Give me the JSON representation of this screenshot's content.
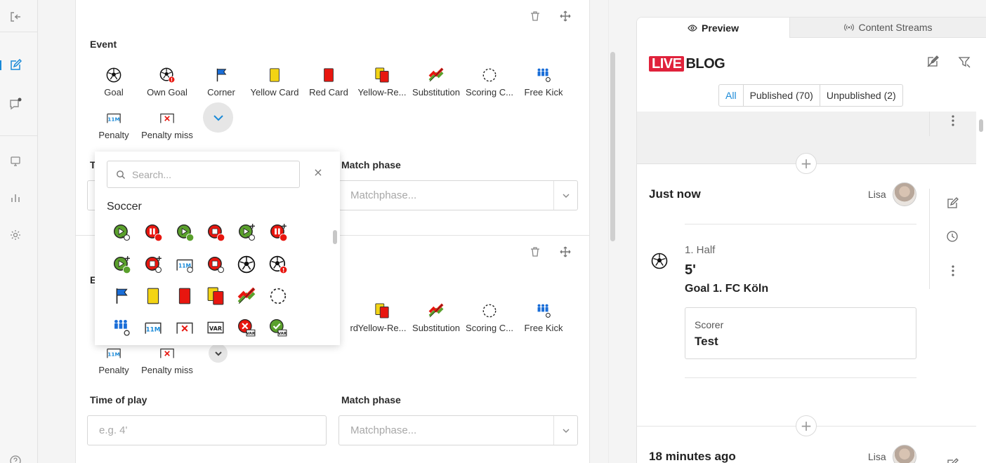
{
  "editor": {
    "event_label": "Event",
    "time_of_play_label": "Time of play",
    "match_phase_label": "Match phase",
    "time_placeholder": "e.g. 4'",
    "matchphase_placeholder": "Matchphase...",
    "events": [
      {
        "label": "Goal",
        "icon": "soccer-ball-icon"
      },
      {
        "label": "Own Goal",
        "icon": "own-goal-icon"
      },
      {
        "label": "Corner",
        "icon": "corner-flag-icon"
      },
      {
        "label": "Yellow Card",
        "icon": "yellow-card-icon"
      },
      {
        "label": "Red Card",
        "icon": "red-card-icon"
      },
      {
        "label": "Yellow-Re...",
        "icon": "yellow-red-card-icon"
      },
      {
        "label": "Substitution",
        "icon": "substitution-icon"
      },
      {
        "label": "Scoring C...",
        "icon": "scoring-chance-icon"
      },
      {
        "label": "Free Kick",
        "icon": "free-kick-icon"
      },
      {
        "label": "Penalty",
        "icon": "penalty-icon"
      },
      {
        "label": "Penalty miss",
        "icon": "penalty-miss-icon"
      }
    ],
    "second_card_events_visible": [
      {
        "label": "rd",
        "icon": ""
      },
      {
        "label": "Yellow-Re...",
        "icon": "yellow-red-card-icon"
      },
      {
        "label": "Substitution",
        "icon": "substitution-icon"
      },
      {
        "label": "Scoring C...",
        "icon": "scoring-chance-icon"
      },
      {
        "label": "Free Kick",
        "icon": "free-kick-icon"
      },
      {
        "label": "Penalty",
        "icon": "penalty-icon"
      },
      {
        "label": "Penalty miss",
        "icon": "penalty-miss-icon"
      }
    ],
    "second_card_partial_label": "E"
  },
  "dropdown": {
    "search_placeholder": "Search...",
    "category": "Soccer",
    "icons": [
      "kickoff-icon",
      "half-time-icon",
      "second-half-icon",
      "game-end-icon",
      "extra-time-icon",
      "extra-time-pause-icon",
      "extra-time-second-half-icon",
      "extra-time-end-icon",
      "penalty-shootout-icon",
      "shootout-end-icon",
      "soccer-ball-icon",
      "own-goal-icon",
      "corner-flag-icon",
      "yellow-card-icon",
      "red-card-icon",
      "yellow-red-card-icon",
      "substitution-icon",
      "scoring-chance-icon",
      "free-kick-icon",
      "penalty-icon",
      "penalty-miss-icon",
      "var-icon",
      "var-rejected-icon",
      "var-confirmed-icon"
    ]
  },
  "preview": {
    "tabs": [
      "Preview",
      "Content Streams"
    ],
    "logo_live": "LIVE",
    "logo_blog": "BLOG",
    "filters": [
      "All",
      "Published (70)",
      "Unpublished (2)"
    ],
    "entry1": {
      "time": "Just now",
      "author": "Lisa",
      "phase": "1. Half",
      "minute": "5'",
      "title": "Goal 1. FC Köln",
      "scorer_label": "Scorer",
      "scorer_value": "Test"
    },
    "entry2": {
      "time": "18 minutes ago",
      "author": "Lisa"
    }
  },
  "colors": {
    "accent": "#1a8ad8",
    "brand_red": "#e0223b",
    "card_yellow": "#f3d414",
    "card_red": "#e8160f",
    "icon_green": "#5aa02c"
  }
}
